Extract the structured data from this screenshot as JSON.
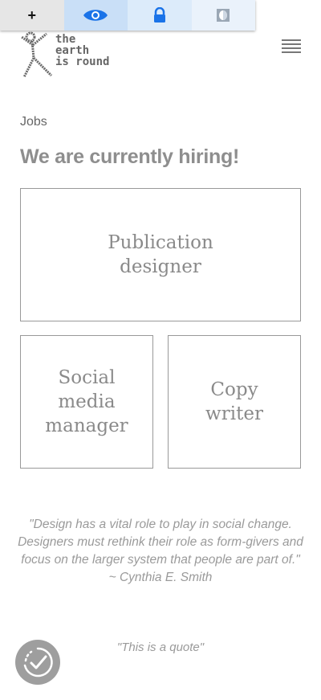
{
  "toolbar": {
    "add_label": "+",
    "items": [
      {
        "icon": "plus-icon"
      },
      {
        "icon": "eye-icon"
      },
      {
        "icon": "lock-icon"
      },
      {
        "icon": "contrast-icon"
      }
    ],
    "accent": "#1a73e8"
  },
  "logo": {
    "text": "the\nearth\nis round"
  },
  "section": {
    "label": "Jobs"
  },
  "headline": "We are currently hiring!",
  "jobs": [
    {
      "title": "Publication\ndesigner"
    },
    {
      "title": "Social\nmedia\nmanager"
    },
    {
      "title": "Copy\nwriter"
    }
  ],
  "quote": "\"Design has a vital role to play in social change. Designers must rethink their role as form-givers and focus on the larger system that people are part of.\" ~ Cynthia E. Smith",
  "quote_secondary": "\"This is a quote\""
}
